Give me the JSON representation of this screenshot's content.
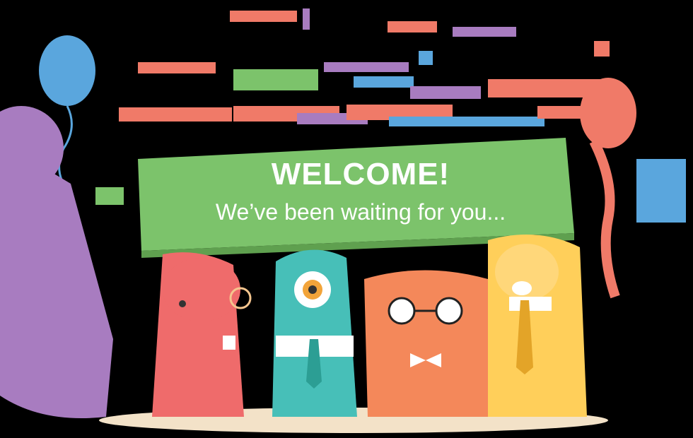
{
  "banner": {
    "title": "WELCOME!",
    "subtitle": "We’ve been waiting for you..."
  },
  "colors": {
    "background": "#000000",
    "banner_green": "#7cc36b",
    "balloon_blue": "#5aa6dd",
    "balloon_purple": "#a87cc0",
    "balloon_salmon": "#f07a68",
    "monster_red": "#ef6b6b",
    "monster_teal": "#47bfb8",
    "monster_orange": "#f4885a",
    "monster_yellow": "#ffcf5a"
  },
  "icons": [
    "balloon-icon",
    "confetti-icon",
    "monster-icon",
    "monocle-icon",
    "glasses-icon",
    "tie-icon",
    "bowtie-icon"
  ]
}
